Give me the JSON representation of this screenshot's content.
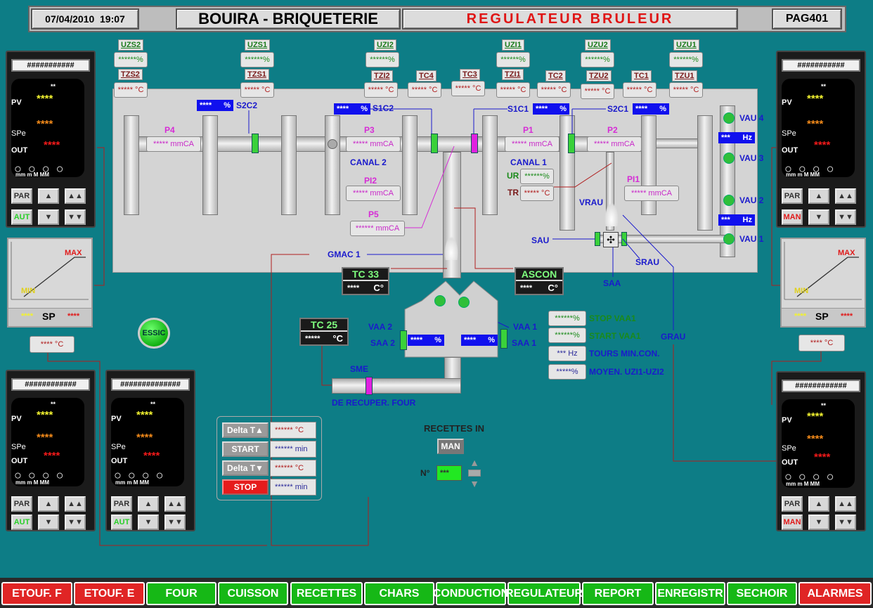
{
  "header": {
    "date": "07/04/2010",
    "time": "19:07",
    "site": "BOUIRA - BRIQUETERIE",
    "title": "REGULATEUR BRULEUR",
    "page": "PAG401"
  },
  "top_tags": [
    {
      "name": "UZS2",
      "val": "******%"
    },
    {
      "name": "UZS1",
      "val": "******%"
    },
    {
      "name": "UZI2",
      "val": "******%"
    },
    {
      "name": "UZI1",
      "val": "******%"
    },
    {
      "name": "UZU2",
      "val": "******%"
    },
    {
      "name": "UZU1",
      "val": "******%"
    }
  ],
  "temp_tags": [
    {
      "name": "TZS2",
      "val": "***** °C"
    },
    {
      "name": "TZS1",
      "val": "***** °C"
    },
    {
      "name": "TZI2",
      "val": "***** °C"
    },
    {
      "name": "TC4",
      "val": "***** °C"
    },
    {
      "name": "TC3",
      "val": "***** °C"
    },
    {
      "name": "TZI1",
      "val": "***** °C"
    },
    {
      "name": "TC2",
      "val": "***** °C"
    },
    {
      "name": "TZU2",
      "val": "***** °C"
    },
    {
      "name": "TC1",
      "val": "***** °C"
    },
    {
      "name": "TZU1",
      "val": "***** °C"
    }
  ],
  "plant": {
    "s2c2": {
      "label": "S2C2",
      "val": "****",
      "unit": "%"
    },
    "s1c2": {
      "label": "S1C2",
      "val": "****",
      "unit": "%"
    },
    "s1c1": {
      "label": "S1C1",
      "val": "****",
      "unit": "%"
    },
    "s2c1": {
      "label": "S2C1",
      "val": "****",
      "unit": "%"
    },
    "p4": {
      "label": "P4",
      "val": "***** mmCA"
    },
    "p3": {
      "label": "P3",
      "val": "***** mmCA"
    },
    "p1": {
      "label": "P1",
      "val": "***** mmCA"
    },
    "p2": {
      "label": "P2",
      "val": "***** mmCA"
    },
    "pi2": {
      "label": "PI2",
      "val": "***** mmCA"
    },
    "pi1": {
      "label": "PI1",
      "val": "***** mmCA"
    },
    "p5": {
      "label": "P5",
      "val": "****** mmCA"
    },
    "canal2": "CANAL 2",
    "canal1": "CANAL 1",
    "ur": {
      "label": "UR",
      "val": "******%"
    },
    "tr": {
      "label": "TR",
      "val": "***** °C"
    },
    "vau4": "VAU 4",
    "vau3": "VAU 3",
    "vau2": "VAU 2",
    "vau1": "VAU 1",
    "hz1": {
      "val": "***",
      "unit": "Hz"
    },
    "hz2": {
      "val": "***",
      "unit": "Hz"
    },
    "vrau": "VRAU",
    "sau": "SAU",
    "srau": "SRAU",
    "saa": "SAA",
    "gmac": "GMAC 1",
    "grau": "GRAU"
  },
  "tc33": {
    "label": "TC 33",
    "val": "****",
    "unit": "C°"
  },
  "ascon": {
    "label": "ASCON",
    "val": "****",
    "unit": "C°"
  },
  "tc25": {
    "label": "TC 25",
    "val": "*****",
    "unit": "°C"
  },
  "vaa": {
    "vaa2": "VAA 2",
    "saa2": "SAA 2",
    "vaa1": "VAA 1",
    "saa1": "SAA 1",
    "v2": "****",
    "v1": "****",
    "unit": "%"
  },
  "sme": "SME",
  "recuper": "DE RECUPER. FOUR",
  "params": [
    {
      "val": "******%",
      "label": "STOP   VAA1"
    },
    {
      "val": "******%",
      "label": "START VAA1"
    },
    {
      "val": "***  Hz",
      "label": "TOURS MIN.CON."
    },
    {
      "val": "*****%",
      "label": "MOYEN. UZI1-UZI2"
    }
  ],
  "essic": "ESSIC",
  "recettes": {
    "title": "RECETTES IN",
    "mode": "MAN",
    "n_label": "N°",
    "n_val": "***"
  },
  "cycle": [
    {
      "btn": "Delta T▲",
      "val": "****** °C"
    },
    {
      "btn": "START",
      "val": "****** min"
    },
    {
      "btn": "Delta T▼",
      "val": "****** °C"
    },
    {
      "btn": "STOP",
      "val": "****** min"
    }
  ],
  "controllers": {
    "tl": {
      "title": "###########",
      "pv": "****",
      "spe": "****",
      "out": "****",
      "mode": "AUT"
    },
    "bl": {
      "title": "############",
      "pv": "****",
      "spe": "****",
      "out": "****",
      "mode": "AUT"
    },
    "bm": {
      "title": "##############",
      "pv": "****",
      "spe": "****",
      "out": "****",
      "mode": "AUT"
    },
    "tr": {
      "title": "###########",
      "pv": "****",
      "spe": "****",
      "out": "****",
      "mode": "MAN"
    },
    "br": {
      "title": "############",
      "pv": "****",
      "spe": "****",
      "out": "****",
      "mode": "MAN"
    }
  },
  "ctrl_labels": {
    "pv": "PV",
    "spe": "SPe",
    "out": "OUT",
    "par": "PAR",
    "scale": "mm   m   M   MM",
    "dot": "**"
  },
  "sp_left": {
    "max": "MAX",
    "min": "MIN",
    "sp": "SP",
    "v1": "****",
    "v2": "****"
  },
  "sp_right": {
    "max": "MAX",
    "min": "MIN",
    "sp": "SP",
    "v1": "****",
    "v2": "****"
  },
  "temp_left": "**** °C",
  "temp_right": "**** °C",
  "nav": [
    "ETOUF. F",
    "ETOUF. E",
    "FOUR",
    "CUISSON",
    "RECETTES",
    "CHARS",
    "CONDUCTION",
    "REGULATEUR",
    "REPORT",
    "ENREGISTR",
    "SECHOIR",
    "ALARMES"
  ]
}
